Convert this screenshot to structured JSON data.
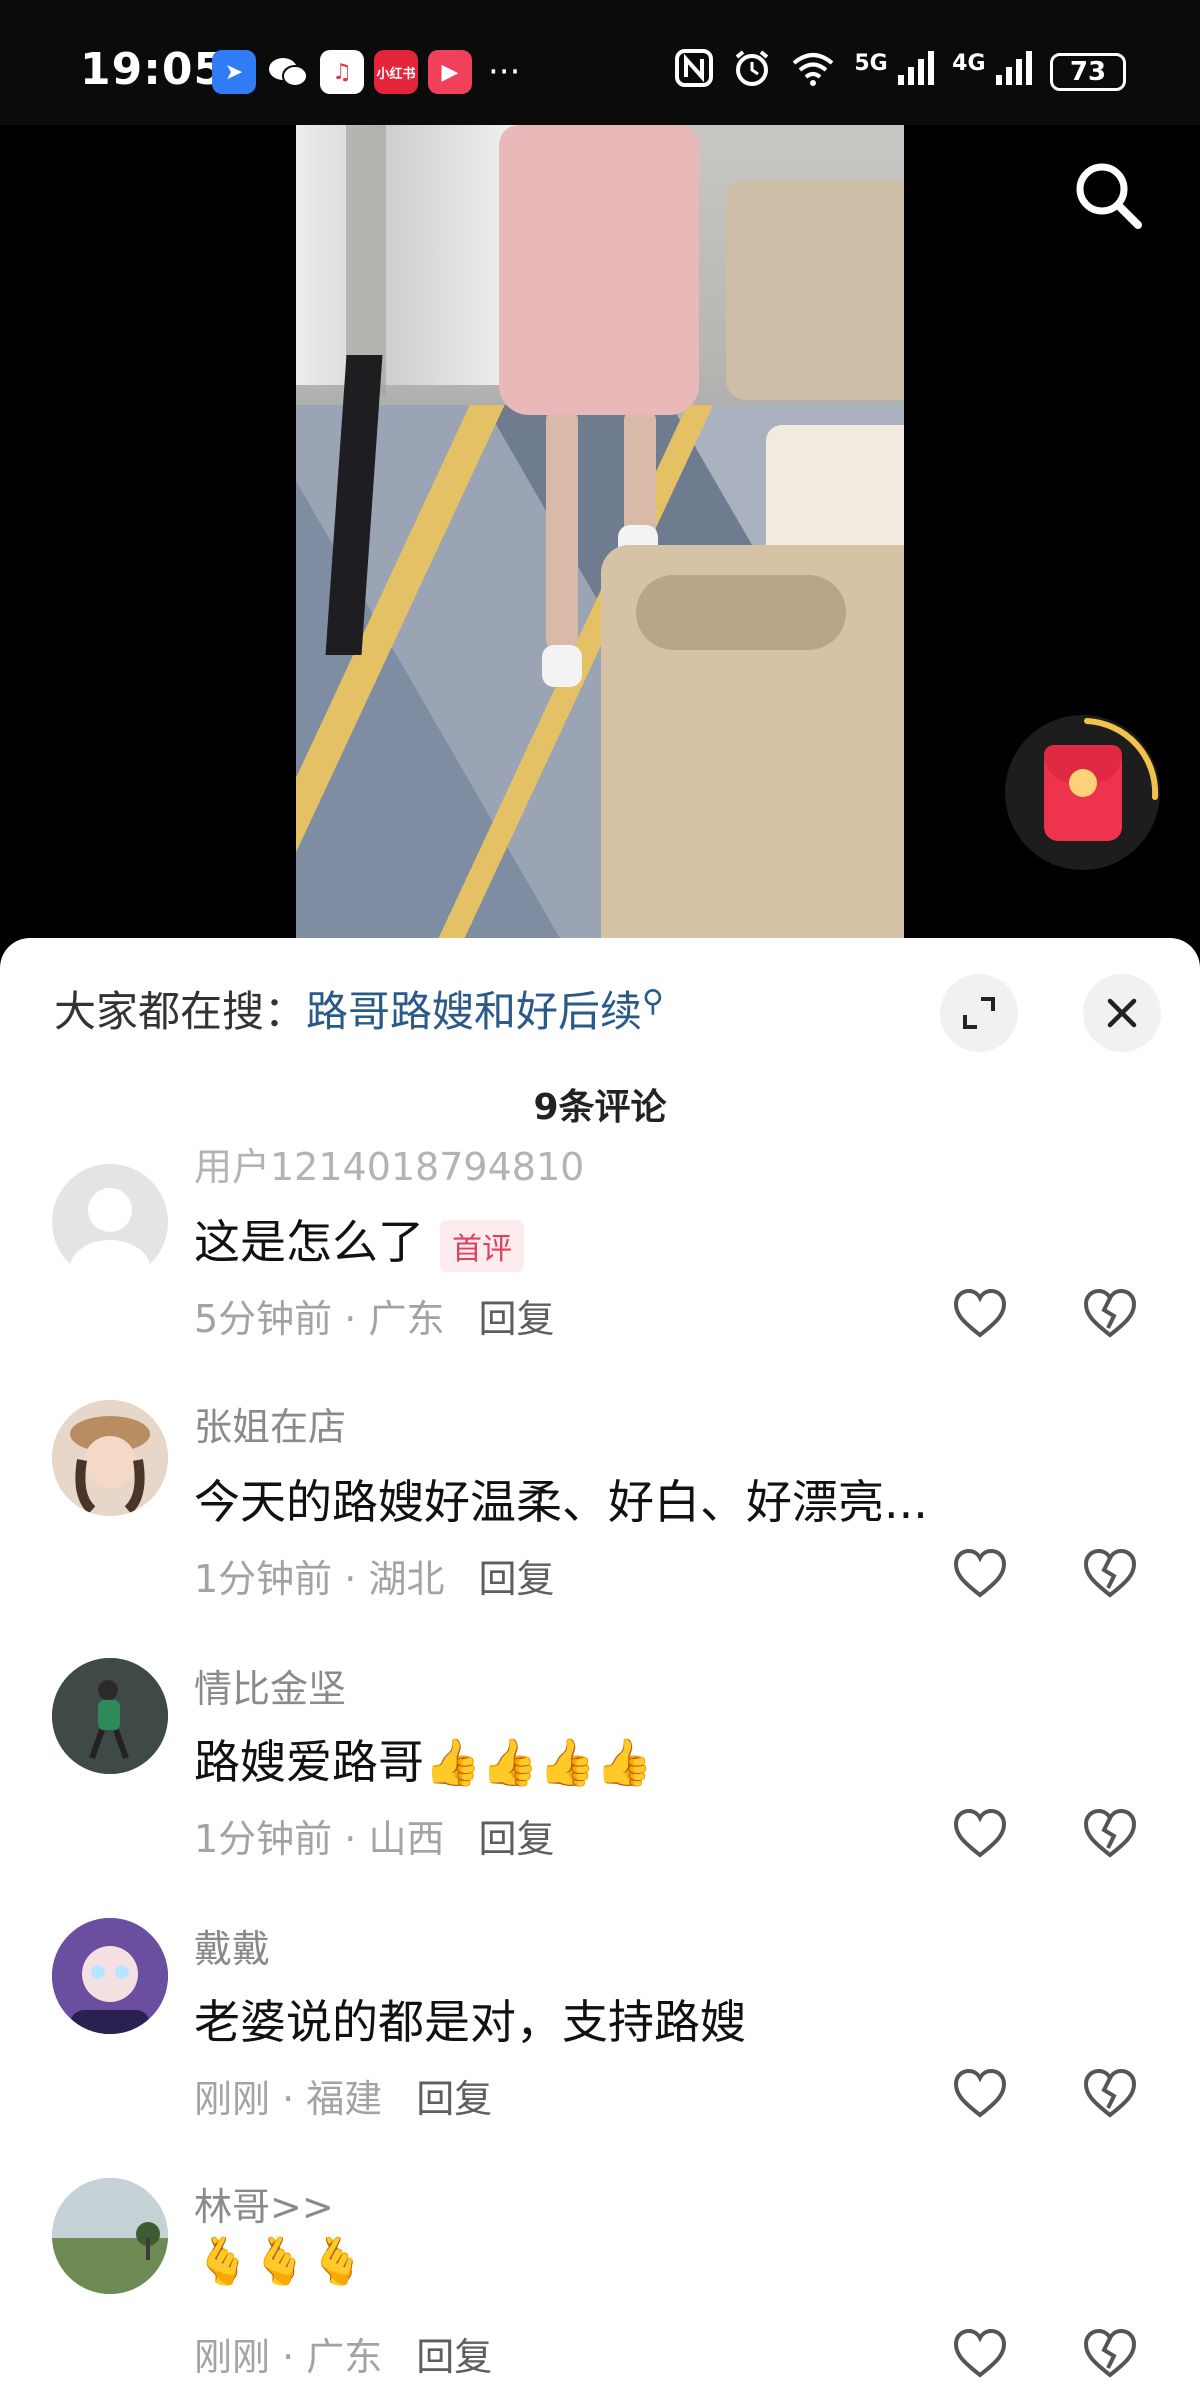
{
  "status_bar": {
    "time": "19:05",
    "app_icons": [
      "maps-icon",
      "wechat-icon",
      "music-icon",
      "xiaohongshu-icon",
      "video-app-icon"
    ],
    "xiaohongshu_label": "小红书",
    "more": "···",
    "network_5g": "5G",
    "network_4g": "4G",
    "battery": "73"
  },
  "video": {
    "search_icon": "search-icon",
    "redpacket_icon": "red-packet-icon"
  },
  "sheet": {
    "hot_search_prefix": "大家都在搜：",
    "hot_search_query": "路哥路嫂和好后续",
    "comment_count": "9条评论"
  },
  "comments": [
    {
      "name": "用户1214018794810",
      "text": "这是怎么了",
      "badge": "首评",
      "time": "5分钟前",
      "location": "广东",
      "reply": "回复"
    },
    {
      "name": "张姐在店",
      "text": "今天的路嫂好温柔、好白、好漂亮...",
      "time": "1分钟前",
      "location": "湖北",
      "reply": "回复"
    },
    {
      "name": "情比金坚",
      "text": "路嫂爱路哥",
      "emoji": "👍👍👍👍",
      "time": "1分钟前",
      "location": "山西",
      "reply": "回复"
    },
    {
      "name": "戴戴",
      "text": "老婆说的都是对，支持路嫂",
      "time": "刚刚",
      "location": "福建",
      "reply": "回复"
    },
    {
      "name": "林哥>>",
      "emoji": "🫰🫰🫰",
      "time": "刚刚",
      "location": "广东",
      "reply": "回复"
    }
  ],
  "colors": {
    "accent_link": "#2a5a8a",
    "badge": "#e0405a",
    "red_packet": "#f0334c"
  }
}
